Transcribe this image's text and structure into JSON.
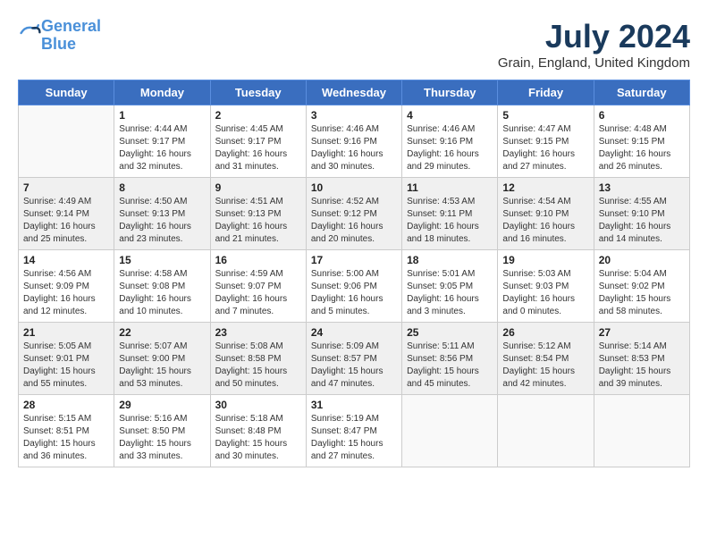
{
  "header": {
    "logo_line1": "General",
    "logo_line2": "Blue",
    "month": "July 2024",
    "location": "Grain, England, United Kingdom"
  },
  "weekdays": [
    "Sunday",
    "Monday",
    "Tuesday",
    "Wednesday",
    "Thursday",
    "Friday",
    "Saturday"
  ],
  "weeks": [
    [
      {
        "day": "",
        "info": ""
      },
      {
        "day": "1",
        "info": "Sunrise: 4:44 AM\nSunset: 9:17 PM\nDaylight: 16 hours\nand 32 minutes."
      },
      {
        "day": "2",
        "info": "Sunrise: 4:45 AM\nSunset: 9:17 PM\nDaylight: 16 hours\nand 31 minutes."
      },
      {
        "day": "3",
        "info": "Sunrise: 4:46 AM\nSunset: 9:16 PM\nDaylight: 16 hours\nand 30 minutes."
      },
      {
        "day": "4",
        "info": "Sunrise: 4:46 AM\nSunset: 9:16 PM\nDaylight: 16 hours\nand 29 minutes."
      },
      {
        "day": "5",
        "info": "Sunrise: 4:47 AM\nSunset: 9:15 PM\nDaylight: 16 hours\nand 27 minutes."
      },
      {
        "day": "6",
        "info": "Sunrise: 4:48 AM\nSunset: 9:15 PM\nDaylight: 16 hours\nand 26 minutes."
      }
    ],
    [
      {
        "day": "7",
        "info": "Sunrise: 4:49 AM\nSunset: 9:14 PM\nDaylight: 16 hours\nand 25 minutes."
      },
      {
        "day": "8",
        "info": "Sunrise: 4:50 AM\nSunset: 9:13 PM\nDaylight: 16 hours\nand 23 minutes."
      },
      {
        "day": "9",
        "info": "Sunrise: 4:51 AM\nSunset: 9:13 PM\nDaylight: 16 hours\nand 21 minutes."
      },
      {
        "day": "10",
        "info": "Sunrise: 4:52 AM\nSunset: 9:12 PM\nDaylight: 16 hours\nand 20 minutes."
      },
      {
        "day": "11",
        "info": "Sunrise: 4:53 AM\nSunset: 9:11 PM\nDaylight: 16 hours\nand 18 minutes."
      },
      {
        "day": "12",
        "info": "Sunrise: 4:54 AM\nSunset: 9:10 PM\nDaylight: 16 hours\nand 16 minutes."
      },
      {
        "day": "13",
        "info": "Sunrise: 4:55 AM\nSunset: 9:10 PM\nDaylight: 16 hours\nand 14 minutes."
      }
    ],
    [
      {
        "day": "14",
        "info": "Sunrise: 4:56 AM\nSunset: 9:09 PM\nDaylight: 16 hours\nand 12 minutes."
      },
      {
        "day": "15",
        "info": "Sunrise: 4:58 AM\nSunset: 9:08 PM\nDaylight: 16 hours\nand 10 minutes."
      },
      {
        "day": "16",
        "info": "Sunrise: 4:59 AM\nSunset: 9:07 PM\nDaylight: 16 hours\nand 7 minutes."
      },
      {
        "day": "17",
        "info": "Sunrise: 5:00 AM\nSunset: 9:06 PM\nDaylight: 16 hours\nand 5 minutes."
      },
      {
        "day": "18",
        "info": "Sunrise: 5:01 AM\nSunset: 9:05 PM\nDaylight: 16 hours\nand 3 minutes."
      },
      {
        "day": "19",
        "info": "Sunrise: 5:03 AM\nSunset: 9:03 PM\nDaylight: 16 hours\nand 0 minutes."
      },
      {
        "day": "20",
        "info": "Sunrise: 5:04 AM\nSunset: 9:02 PM\nDaylight: 15 hours\nand 58 minutes."
      }
    ],
    [
      {
        "day": "21",
        "info": "Sunrise: 5:05 AM\nSunset: 9:01 PM\nDaylight: 15 hours\nand 55 minutes."
      },
      {
        "day": "22",
        "info": "Sunrise: 5:07 AM\nSunset: 9:00 PM\nDaylight: 15 hours\nand 53 minutes."
      },
      {
        "day": "23",
        "info": "Sunrise: 5:08 AM\nSunset: 8:58 PM\nDaylight: 15 hours\nand 50 minutes."
      },
      {
        "day": "24",
        "info": "Sunrise: 5:09 AM\nSunset: 8:57 PM\nDaylight: 15 hours\nand 47 minutes."
      },
      {
        "day": "25",
        "info": "Sunrise: 5:11 AM\nSunset: 8:56 PM\nDaylight: 15 hours\nand 45 minutes."
      },
      {
        "day": "26",
        "info": "Sunrise: 5:12 AM\nSunset: 8:54 PM\nDaylight: 15 hours\nand 42 minutes."
      },
      {
        "day": "27",
        "info": "Sunrise: 5:14 AM\nSunset: 8:53 PM\nDaylight: 15 hours\nand 39 minutes."
      }
    ],
    [
      {
        "day": "28",
        "info": "Sunrise: 5:15 AM\nSunset: 8:51 PM\nDaylight: 15 hours\nand 36 minutes."
      },
      {
        "day": "29",
        "info": "Sunrise: 5:16 AM\nSunset: 8:50 PM\nDaylight: 15 hours\nand 33 minutes."
      },
      {
        "day": "30",
        "info": "Sunrise: 5:18 AM\nSunset: 8:48 PM\nDaylight: 15 hours\nand 30 minutes."
      },
      {
        "day": "31",
        "info": "Sunrise: 5:19 AM\nSunset: 8:47 PM\nDaylight: 15 hours\nand 27 minutes."
      },
      {
        "day": "",
        "info": ""
      },
      {
        "day": "",
        "info": ""
      },
      {
        "day": "",
        "info": ""
      }
    ]
  ]
}
